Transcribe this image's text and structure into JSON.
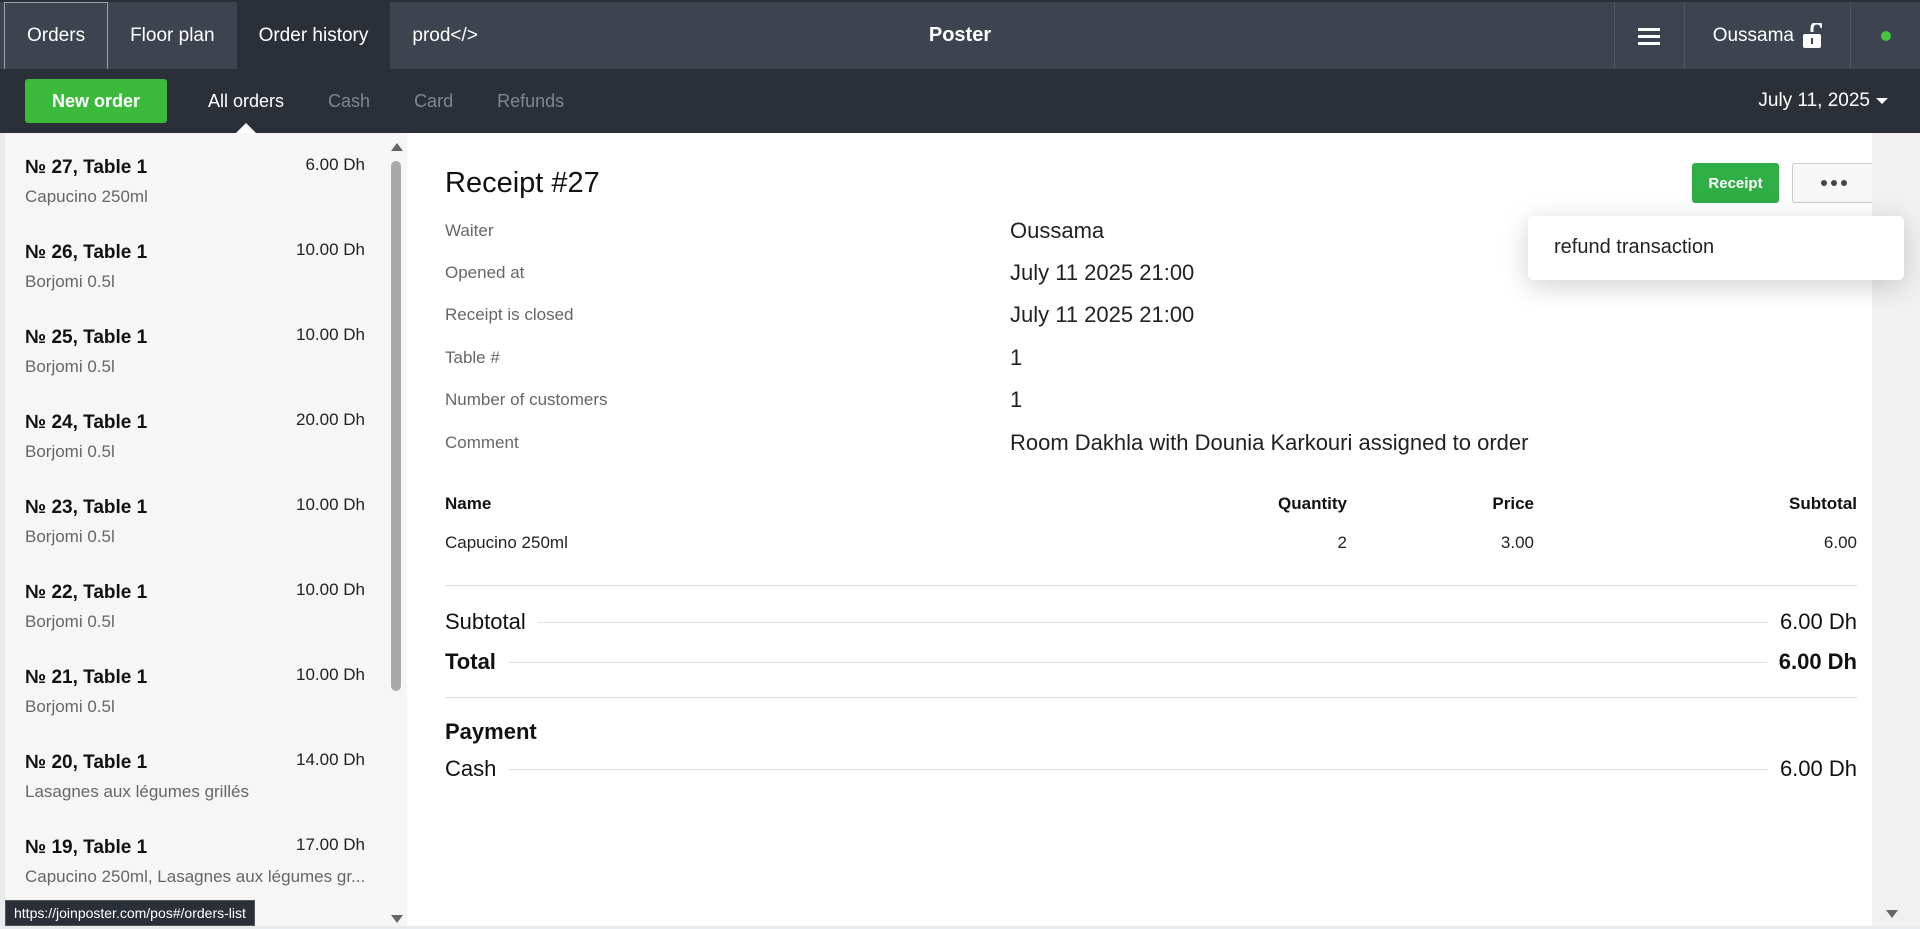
{
  "topbar": {
    "tabs": [
      {
        "label": "Orders"
      },
      {
        "label": "Floor plan"
      },
      {
        "label": "Order history"
      },
      {
        "label": "prod</>"
      }
    ],
    "app_title": "Poster",
    "user_name": "Oussama",
    "status_color": "#46c541"
  },
  "subbar": {
    "new_order_label": "New order",
    "filters": [
      {
        "label": "All orders"
      },
      {
        "label": "Cash"
      },
      {
        "label": "Card"
      },
      {
        "label": "Refunds"
      }
    ],
    "date": "July 11, 2025"
  },
  "orders": [
    {
      "title": "№ 27, Table 1",
      "amount": "6.00 Dh",
      "items": "Capucino 250ml"
    },
    {
      "title": "№ 26, Table 1",
      "amount": "10.00 Dh",
      "items": "Borjomi 0.5l"
    },
    {
      "title": "№ 25, Table 1",
      "amount": "10.00 Dh",
      "items": "Borjomi 0.5l"
    },
    {
      "title": "№ 24, Table 1",
      "amount": "20.00 Dh",
      "items": "Borjomi 0.5l"
    },
    {
      "title": "№ 23, Table 1",
      "amount": "10.00 Dh",
      "items": "Borjomi 0.5l"
    },
    {
      "title": "№ 22, Table 1",
      "amount": "10.00 Dh",
      "items": "Borjomi 0.5l"
    },
    {
      "title": "№ 21, Table 1",
      "amount": "10.00 Dh",
      "items": "Borjomi 0.5l"
    },
    {
      "title": "№ 20, Table 1",
      "amount": "14.00 Dh",
      "items": "Lasagnes aux légumes grillés"
    },
    {
      "title": "№ 19, Table 1",
      "amount": "17.00 Dh",
      "items": "Capucino 250ml, Lasagnes aux légumes gr..."
    }
  ],
  "status_url": "https://joinposter.com/pos#/orders-list",
  "receipt": {
    "title": "Receipt #27",
    "receipt_button": "Receipt",
    "info": [
      {
        "label": "Waiter",
        "value": "Oussama"
      },
      {
        "label": "Opened at",
        "value": "July 11 2025 21:00"
      },
      {
        "label": "Receipt is closed",
        "value": "July 11 2025 21:00"
      },
      {
        "label": "Table #",
        "value": "1"
      },
      {
        "label": "Number of customers",
        "value": "1"
      },
      {
        "label": "Comment",
        "value": "Room Dakhla with Dounia Karkouri assigned to order"
      }
    ],
    "columns": {
      "name": "Name",
      "quantity": "Quantity",
      "price": "Price",
      "subtotal": "Subtotal"
    },
    "items": [
      {
        "name": "Capucino 250ml",
        "quantity": "2",
        "price": "3.00",
        "subtotal": "6.00"
      }
    ],
    "subtotal_label": "Subtotal",
    "subtotal_value": "6.00 Dh",
    "total_label": "Total",
    "total_value": "6.00 Dh",
    "payment_title": "Payment",
    "payment_method": "Cash",
    "payment_value": "6.00 Dh"
  },
  "popup": {
    "item": "refund transaction"
  }
}
